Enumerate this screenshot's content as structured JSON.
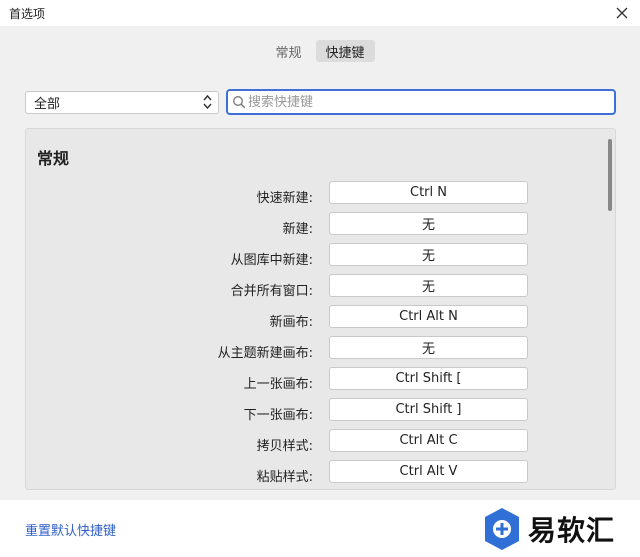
{
  "window": {
    "title": "首选项"
  },
  "tabs": [
    {
      "label": "常规",
      "active": false
    },
    {
      "label": "快捷键",
      "active": true
    }
  ],
  "filter": {
    "selected": "全部"
  },
  "search": {
    "placeholder": "搜索快捷键",
    "value": ""
  },
  "section": {
    "title": "常规"
  },
  "shortcuts": [
    {
      "label": "快速新建:",
      "key": "Ctrl N"
    },
    {
      "label": "新建:",
      "key": "无"
    },
    {
      "label": "从图库中新建:",
      "key": "无"
    },
    {
      "label": "合并所有窗口:",
      "key": "无"
    },
    {
      "label": "新画布:",
      "key": "Ctrl Alt N"
    },
    {
      "label": "从主题新建画布:",
      "key": "无"
    },
    {
      "label": "上一张画布:",
      "key": "Ctrl Shift ["
    },
    {
      "label": "下一张画布:",
      "key": "Ctrl Shift ]"
    },
    {
      "label": "拷贝样式:",
      "key": "Ctrl Alt C"
    },
    {
      "label": "粘贴样式:",
      "key": "Ctrl Alt V"
    }
  ],
  "footer": {
    "reset_label": "重置默认快捷键"
  },
  "watermark": {
    "brand": "易软汇",
    "accent": "#2f6fd6"
  },
  "colors": {
    "accent": "#3d6fd8",
    "link": "#2f5fc8"
  }
}
